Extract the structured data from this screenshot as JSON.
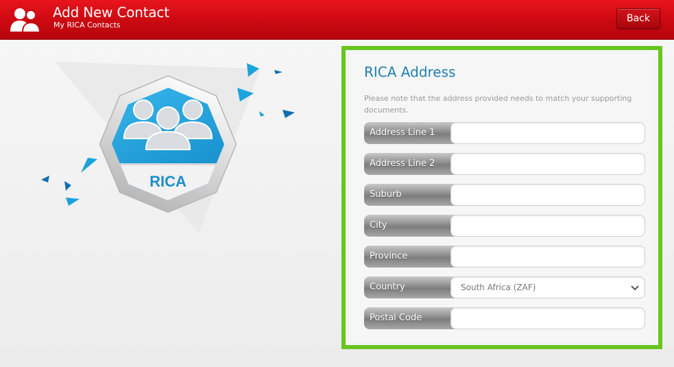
{
  "header": {
    "title": "Add New Contact",
    "subtitle": "My RICA Contacts",
    "back_label": "Back",
    "icon": "contacts-icon",
    "color": "#d00c13"
  },
  "illustration": {
    "badge_label": "RICA",
    "icon": "group-icon",
    "accent": "#1aa3dc"
  },
  "form": {
    "title": "RICA Address",
    "note": "Please note that the address provided needs to match your supporting documents.",
    "border_color": "#69c51f",
    "fields": [
      {
        "label": "Address Line 1",
        "value": ""
      },
      {
        "label": "Address Line 2",
        "value": ""
      },
      {
        "label": "Suburb",
        "value": ""
      },
      {
        "label": "City",
        "value": ""
      },
      {
        "label": "Province",
        "value": ""
      },
      {
        "label": "Country",
        "value": "South Africa (ZAF)"
      },
      {
        "label": "Postal Code",
        "value": ""
      }
    ]
  }
}
